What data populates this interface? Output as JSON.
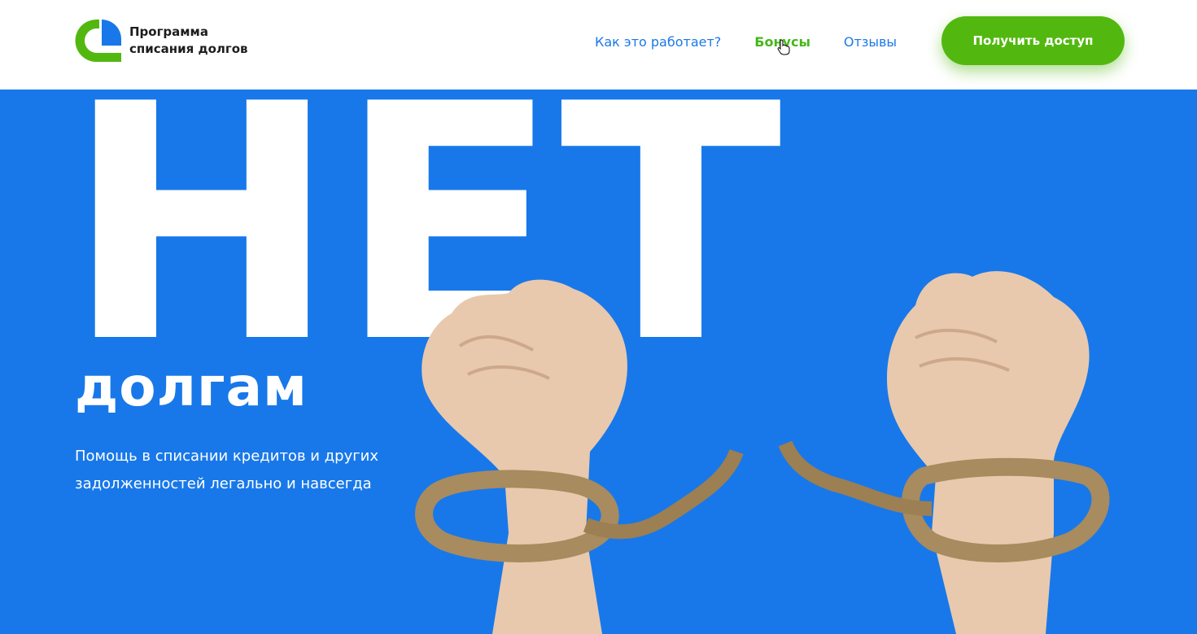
{
  "header": {
    "logo": {
      "line1": "Программа",
      "line2": "списания долгов",
      "mark_icon": "logo-mark-icon"
    },
    "nav": [
      {
        "label": "Как это работает?",
        "active": false
      },
      {
        "label": "Бонусы",
        "active": true
      },
      {
        "label": "Отзывы",
        "active": false
      }
    ],
    "cta_label": "Получить доступ"
  },
  "hero": {
    "big_word": "НЕТ",
    "subtitle": "долгам",
    "description": "Помощь в списании кредитов и других задолженностей легально и навсегда",
    "image": "raised-fists-breaking-rope-photo"
  },
  "colors": {
    "hero_bg": "#1878e9",
    "brand_green": "#52b80f",
    "nav_link": "#1b78e8",
    "nav_active": "#46b71a",
    "text_dark": "#1d1d1f",
    "white": "#ffffff"
  }
}
